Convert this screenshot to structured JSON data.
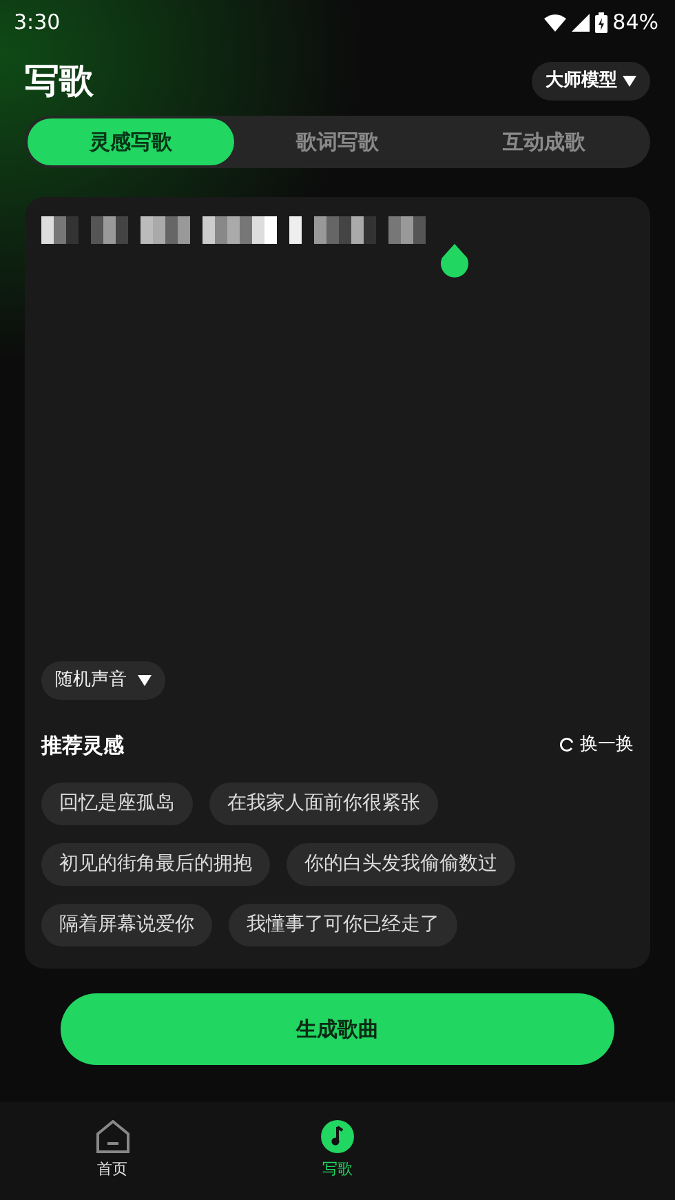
{
  "status_bar": {
    "time": "3:30",
    "battery": "84%"
  },
  "header": {
    "title": "写歌",
    "model_button": "大师模型"
  },
  "tabs": [
    {
      "label": "灵感写歌",
      "selected": true
    },
    {
      "label": "歌词写歌",
      "selected": false
    },
    {
      "label": "互动成歌",
      "selected": false
    }
  ],
  "voice_dropdown": "随机声音",
  "recommendations": {
    "title": "推荐灵感",
    "refresh": "换一换",
    "chips": [
      "回忆是座孤岛",
      "在我家人面前你很紧张",
      "初见的街角最后的拥抱",
      "你的白头发我偷偷数过",
      "隔着屏幕说爱你",
      "我懂事了可你已经走了"
    ]
  },
  "generate_button": "生成歌曲",
  "bottom_nav": [
    {
      "label": "首页",
      "kind": "home",
      "selected": false
    },
    {
      "label": "写歌",
      "kind": "music",
      "selected": true
    }
  ]
}
